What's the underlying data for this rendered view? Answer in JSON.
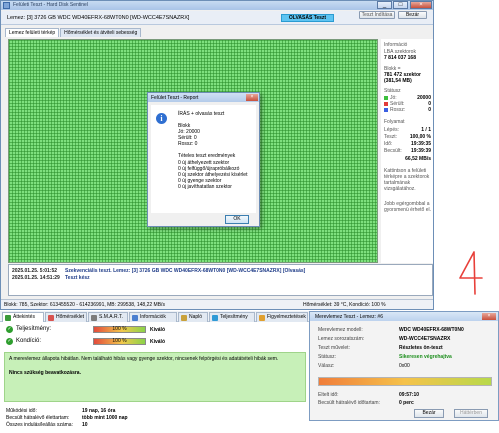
{
  "main_window": {
    "title": "Felületi Teszt - Hard Disk Sentinel",
    "disk_label": "Lemez: [3] 3726 GB  WDC WD40EFRX-68WT0N0 [WD-WCC4E7SNAZRX]",
    "status_badge": "OLVASÁS Teszt",
    "buttons": {
      "start": "Teszt Indítása",
      "close": "Bezár"
    },
    "tabs": [
      "Lemez felületi térkép",
      "Hőmérséklet és átviteli sebesség"
    ],
    "window_controls": {
      "minimize": "_",
      "maximize": "□",
      "close": "×"
    }
  },
  "side_panel": {
    "info_title": "Információ",
    "lba_label": "LBA szektorok",
    "lba_value": "7 814 037 168",
    "block_label": "Blokk =",
    "block_value": "781 472 szektor",
    "block_size": "(381,54 MB)",
    "status_title": "Státusz",
    "status": [
      {
        "label": "Jó:",
        "value": "20000",
        "color": "#3cbf3c"
      },
      {
        "label": "Sérült:",
        "value": "0",
        "color": "#e23b3b"
      },
      {
        "label": "Rossz:",
        "value": "0",
        "color": "#3b5fe2"
      }
    ],
    "progress_title": "Folyamat",
    "progress": [
      {
        "label": "Lépés:",
        "value": "1 / 1"
      },
      {
        "label": "Teszt:",
        "value": "100,00 %"
      },
      {
        "label": "Idő:",
        "value": "19:39:35"
      },
      {
        "label": "Becsült:",
        "value": "19:39:39"
      },
      {
        "label": "",
        "value": "66,52 MB/s"
      }
    ],
    "hint1": "Kattintson a felületi térképre a szektorok tartalmának vizsgálatához.",
    "hint2": "Jobb egérgombbal a gyorsmenü érhető el."
  },
  "log": [
    {
      "time": "2025.01.25.  5:01:52",
      "text": "Szekvenciális teszt. Lemez: [3] 3726 GB  WDC WD40EFRX-68WT0N0 [WD-WCC4E7SNAZRX] [Olvasás]"
    },
    {
      "time": "2025.01.25.  14:51:29",
      "text": "Teszt kész"
    }
  ],
  "statusbar": {
    "left": "Blokk: 785, Szektor: 613455520 - 614236991, MB: 299538, 148,22 MB/s",
    "right": "Hőmérséklet: 39 °C,  Kondíció: 100 %"
  },
  "report_dialog": {
    "title": "Felület Teszt - Report",
    "close": "×",
    "lines": [
      "ÍRÁS + olvasás teszt",
      "",
      "Blokk",
      "  Jó: 20000",
      "  Sérült: 0",
      "  Rossz: 0",
      "",
      "Tételes teszt eredmények",
      "  0 új áthelyezett szektor",
      "  0 új felfüggő/újrapróbálkozó",
      "  0 új szektor áthelyezési kísérlet",
      "  0 új gyenge szektor",
      "  0 új javíthatatlan szektor"
    ],
    "ok_label": "OK"
  },
  "annotation": {
    "handwritten": "4",
    "color": "#e8403a"
  },
  "bottom_window": {
    "tabs": [
      {
        "label": "Áttekintés",
        "color": "#3a9a3a"
      },
      {
        "label": "Hőmérséklet",
        "color": "#d9534f"
      },
      {
        "label": "S.M.A.R.T.",
        "color": "#7b7b7b"
      },
      {
        "label": "Információk",
        "color": "#4a7fd0"
      },
      {
        "label": "Napló",
        "color": "#c9a13a"
      },
      {
        "label": "Teljesítmény",
        "color": "#2f9ad6"
      },
      {
        "label": "Figyelmeztetések",
        "color": "#e0a030"
      }
    ],
    "performance": {
      "label": "Teljesítmény:",
      "bar": "100 %",
      "rating": "Kiváló"
    },
    "health": {
      "label": "Kondíció:",
      "bar": "100 %",
      "rating": "Kiváló"
    },
    "message": "A merevlemez állapota hibátlan. Nem található hibás vagy gyenge szektor, nincsenek felpörgési és adatátviteli hibák sem.",
    "action": "Nincs szükség beavatkozásra.",
    "info": [
      {
        "label": "Működési idő:",
        "value": "19 nap, 16 óra"
      },
      {
        "label": "Becsült hátralévő élettartam:",
        "value": "több mint 1000 nap"
      },
      {
        "label": "Összes indulás/leállás száma:",
        "value": "10"
      }
    ]
  },
  "surface_window": {
    "title": "Merevlemez Teszt - Lemez: #6",
    "close": "×",
    "rows": [
      {
        "label": "Merevlemez modell:",
        "value": "WDC WD40EFRX-68WT0N0"
      },
      {
        "label": "Lemez sorozatszám:",
        "value": "WD-WCC4E7SNAZRX"
      },
      {
        "label": "Teszt művelet:",
        "value": "Részletes ön-teszt"
      },
      {
        "label": "Státusz:",
        "value": "Sikeresen végrehajtva"
      },
      {
        "label": "Válasz:",
        "value": "0x00"
      }
    ],
    "progress": 1.0,
    "elapsed_label": "Eltelt idő:",
    "elapsed": "09:57:10",
    "remaining_label": "Becsült hátralévő időtartam:",
    "remaining": "0 perc",
    "buttons": {
      "close": "Bezár",
      "abort": "Háttérben"
    }
  }
}
